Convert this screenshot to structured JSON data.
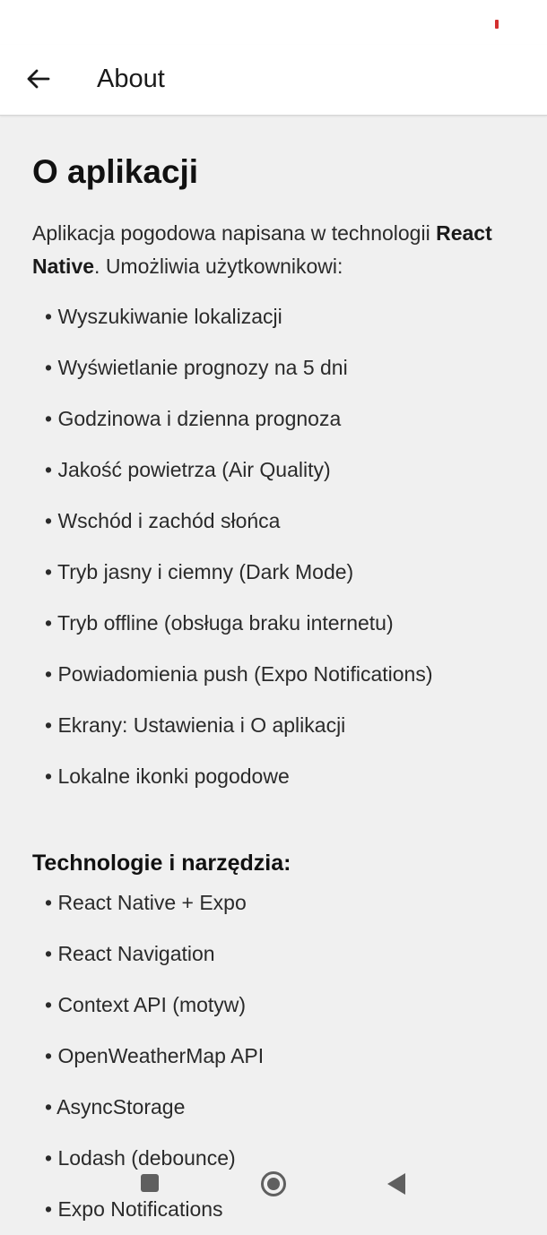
{
  "colors": {
    "status_indicator": "#d32f2f",
    "nav_icons": "#5f5f5f"
  },
  "header": {
    "title": "About",
    "back_icon": "arrow-left-icon"
  },
  "content": {
    "heading": "O aplikacji",
    "intro_text_1": "Aplikacja pogodowa napisana w technologii ",
    "intro_bold": "React Native",
    "intro_text_2": ". Umożliwia użytkownikowi:",
    "features": [
      "• Wyszukiwanie lokalizacji",
      "• Wyświetlanie prognozy na 5 dni",
      "• Godzinowa i dzienna prognoza",
      "• Jakość powietrza (Air Quality)",
      "• Wschód i zachód słońca",
      "• Tryb jasny i ciemny (Dark Mode)",
      "• Tryb offline (obsługa braku internetu)",
      "• Powiadomienia push (Expo Notifications)",
      "• Ekrany: Ustawienia i O aplikacji",
      "• Lokalne ikonki pogodowe"
    ],
    "tech_heading": "Technologie i narzędzia:",
    "tech": [
      "• React Native + Expo",
      "• React Navigation",
      "• Context API (motyw)",
      "• OpenWeatherMap API",
      "• AsyncStorage",
      "• Lodash (debounce)",
      "• Expo Notifications"
    ]
  },
  "nav_bar": {
    "recents_icon": "square-recents-icon",
    "home_icon": "circle-home-icon",
    "back_icon": "triangle-back-icon"
  }
}
